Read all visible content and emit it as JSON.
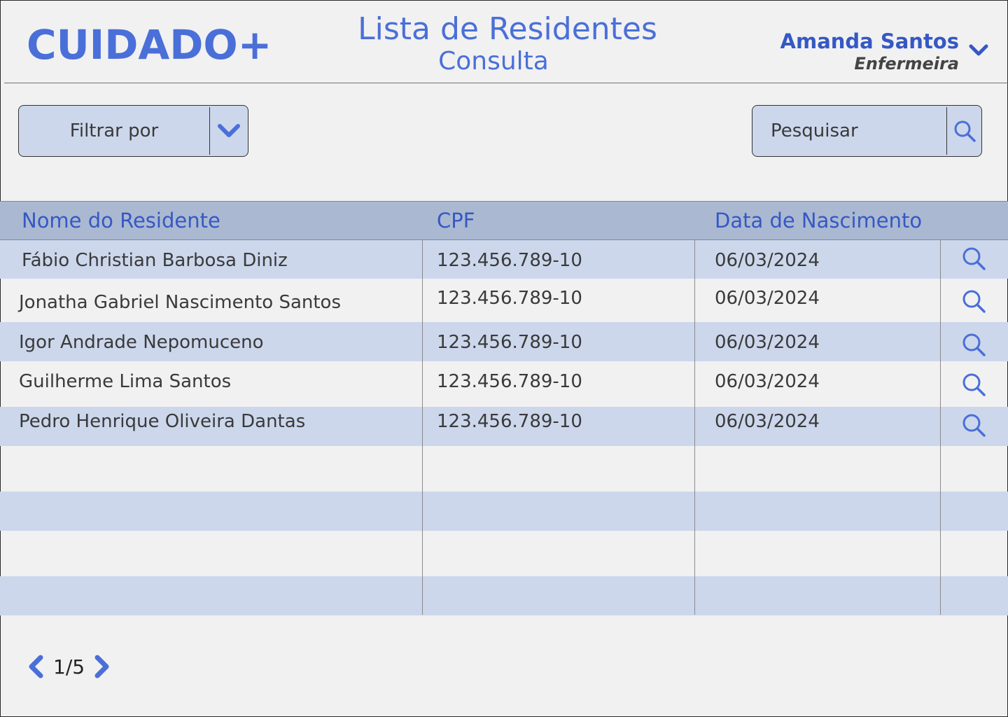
{
  "app": {
    "logo": "CUIDADO+"
  },
  "header": {
    "title": "Lista de Residentes",
    "subtitle": "Consulta"
  },
  "user": {
    "name": "Amanda Santos",
    "role": "Enfermeira"
  },
  "filter": {
    "label": "Filtrar por"
  },
  "search": {
    "placeholder": "Pesquisar"
  },
  "table": {
    "columns": [
      "Nome do Residente",
      "CPF",
      "Data de Nascimento"
    ],
    "rows": [
      {
        "name": "Fábio Christian Barbosa Diniz",
        "cpf": "123.456.789-10",
        "birth": "06/03/2024"
      },
      {
        "name": "Jonatha Gabriel Nascimento Santos",
        "cpf": "123.456.789-10",
        "birth": "06/03/2024"
      },
      {
        "name": "Igor Andrade Nepomuceno",
        "cpf": "123.456.789-10",
        "birth": "06/03/2024"
      },
      {
        "name": "Guilherme Lima Santos",
        "cpf": "123.456.789-10",
        "birth": "06/03/2024"
      },
      {
        "name": "Pedro Henrique Oliveira Dantas",
        "cpf": "123.456.789-10",
        "birth": "06/03/2024"
      }
    ]
  },
  "pagination": {
    "label": "1/5"
  },
  "colors": {
    "accent": "#4a6fd8",
    "rowShade": "#ccd7ec",
    "headerBg": "#aab9d1",
    "background": "#f1f1f2"
  },
  "icons": {
    "search": "search-icon",
    "chevron": "chevron-down-icon",
    "prev": "chevron-left-icon",
    "next": "chevron-right-icon"
  }
}
